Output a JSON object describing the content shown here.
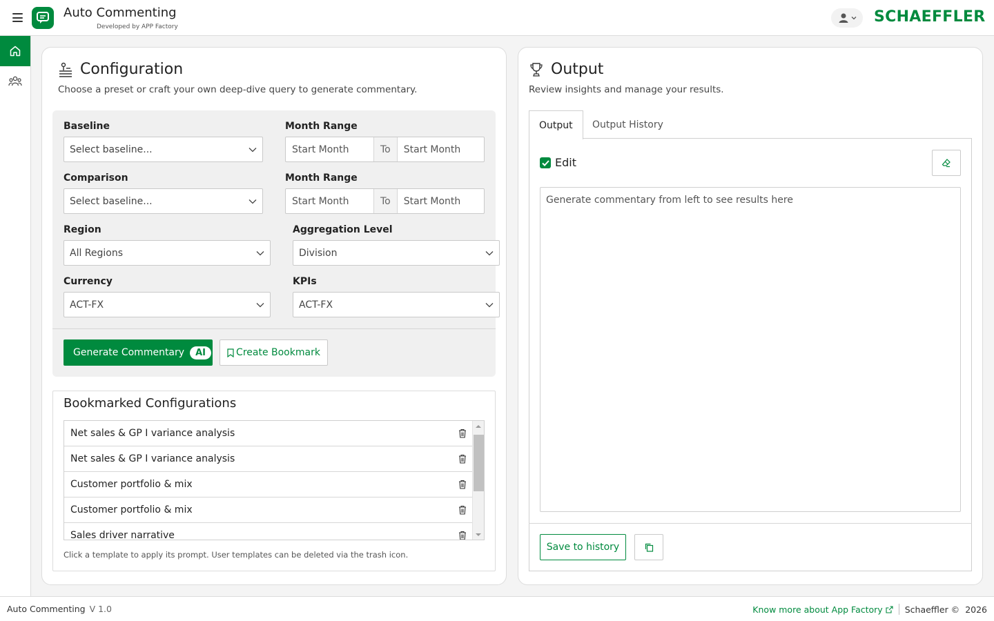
{
  "header": {
    "title": "Auto Commenting",
    "subtitle": "Developed by APP Factory",
    "brand": "SCHAEFFLER"
  },
  "icons": {
    "menu": "hamburger-icon",
    "logo": "chat-bubble-icon",
    "user": "user-icon",
    "home": "home-icon",
    "team": "users-icon"
  },
  "colors": {
    "accent": "#008a3e"
  },
  "configuration": {
    "title": "Configuration",
    "subtitle": "Choose a preset or craft your own deep-dive query to generate commentary.",
    "baseline": {
      "label": "Baseline",
      "value": "Select baseline..."
    },
    "baseline_range": {
      "label": "Month Range",
      "from": "Start Month",
      "to_label": "To",
      "to": "Start Month"
    },
    "comparison": {
      "label": "Comparison",
      "value": "Select baseline..."
    },
    "comparison_range": {
      "label": "Month Range",
      "from": "Start Month",
      "to_label": "To",
      "to": "Start Month"
    },
    "region": {
      "label": "Region",
      "value": "All Regions"
    },
    "aggregation": {
      "label": "Aggregation Level",
      "value": "Division"
    },
    "currency": {
      "label": "Currency",
      "value": "ACT-FX"
    },
    "kpis": {
      "label": "KPIs",
      "value": "ACT-FX"
    },
    "generate_label": "Generate Commentary",
    "ai_badge": "AI",
    "bookmark_label": "Create Bookmark"
  },
  "bookmarks": {
    "title": "Bookmarked Configurations",
    "items": [
      "Net sales & GP I variance analysis",
      "Net sales & GP I variance analysis",
      "Customer portfolio & mix",
      "Customer portfolio & mix",
      "Sales driver narrative"
    ],
    "hint": "Click a template to apply its prompt. User templates can be deleted via the trash icon."
  },
  "output": {
    "title": "Output",
    "subtitle": "Review insights and manage your results.",
    "tabs": [
      "Output",
      "Output History"
    ],
    "edit_label": "Edit",
    "edit_checked": true,
    "placeholder": "Generate commentary from left to see results here",
    "save_label": "Save to history"
  },
  "footer": {
    "app": "Auto Commenting",
    "version": "V 1.0",
    "link": "Know more about App Factory",
    "company": "Schaeffler ©",
    "year": "2026"
  }
}
